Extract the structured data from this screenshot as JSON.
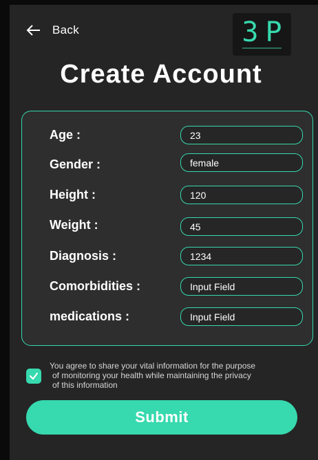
{
  "header": {
    "back_label": "Back",
    "logo_text": "3P",
    "title": "Create Account"
  },
  "form": {
    "fields": [
      {
        "label": "Age :",
        "value": "23"
      },
      {
        "label": "Gender :",
        "value": "female"
      },
      {
        "label": "Height :",
        "value": "120"
      },
      {
        "label": "Weight :",
        "value": "45"
      },
      {
        "label": "Diagnosis :",
        "value": "1234"
      },
      {
        "label": "Comorbidities :",
        "value": "Input Field"
      },
      {
        "label": "medications :",
        "value": "Input Field"
      }
    ]
  },
  "consent": {
    "checked": true,
    "line1": "You agree to share your vital information for the purpose",
    "line2": "of monitoring your health while maintaining the privacy",
    "line3": "of this information"
  },
  "submit_label": "Submit",
  "colors": {
    "accent": "#37d9ae",
    "background": "#252525",
    "card": "#2e2e2e",
    "text": "#ffffff"
  },
  "icons": {
    "back": "arrow-left-icon",
    "checkbox": "check-icon"
  }
}
